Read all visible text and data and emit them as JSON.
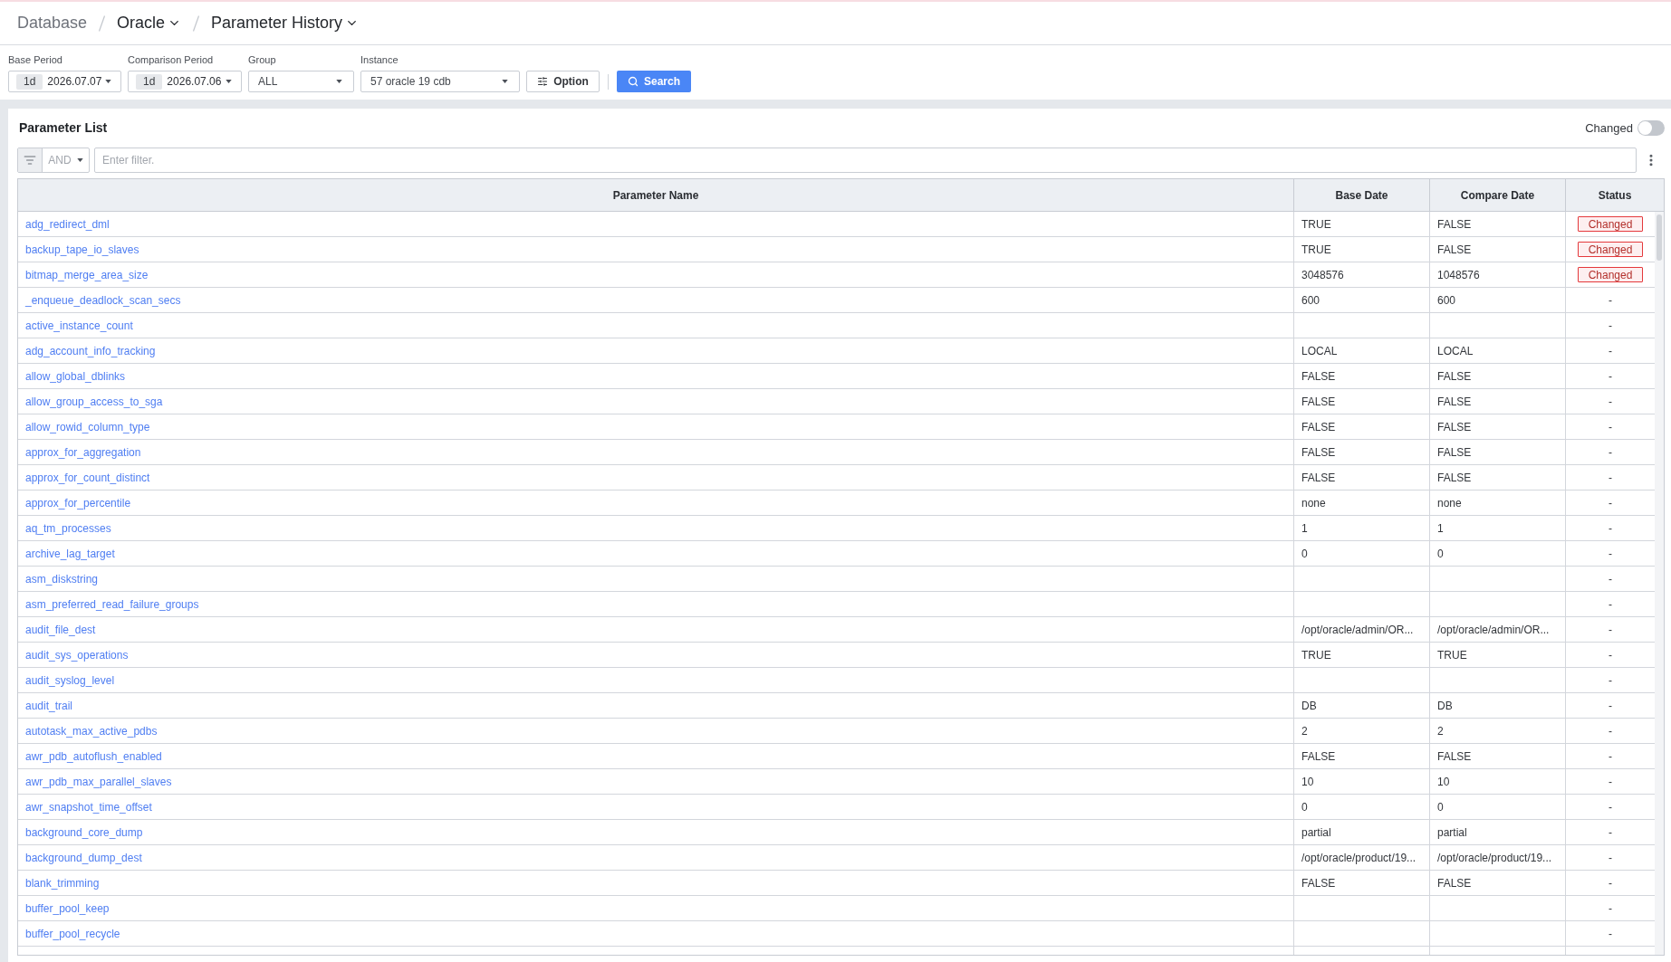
{
  "breadcrumb": [
    {
      "kind": "link",
      "label": "Database"
    },
    {
      "kind": "menu",
      "label": "Oracle"
    },
    {
      "kind": "menu",
      "label": "Parameter History"
    }
  ],
  "filters": [
    {
      "kind": "period",
      "label": "Base Period",
      "range": "1d",
      "value": "2026.07.07"
    },
    {
      "kind": "period",
      "label": "Comparison Period",
      "range": "1d",
      "value": "2026.07.06"
    },
    {
      "kind": "select",
      "label": "Group",
      "value": "ALL"
    },
    {
      "kind": "select",
      "label": "Instance",
      "value": "57 oracle 19 cdb"
    }
  ],
  "option_button": {
    "label": "Option"
  },
  "search_button": {
    "label": "Search"
  },
  "parameter_list": {
    "title": "Parameter List",
    "changed_filter": {
      "label": "Changed",
      "on": false
    },
    "filter": {
      "operator": "AND",
      "placeholder": "Enter filter."
    },
    "columns": [
      "Parameter Name",
      "Base Date",
      "Compare Date",
      "Status"
    ],
    "rows": [
      {
        "name": "adg_redirect_dml",
        "base": "TRUE",
        "compare": "FALSE",
        "status": "Changed",
        "changed": true
      },
      {
        "name": "backup_tape_io_slaves",
        "base": "TRUE",
        "compare": "FALSE",
        "status": "Changed",
        "changed": true
      },
      {
        "name": "bitmap_merge_area_size",
        "base": "3048576",
        "compare": "1048576",
        "status": "Changed",
        "changed": true
      },
      {
        "name": "_enqueue_deadlock_scan_secs",
        "base": "600",
        "compare": "600",
        "status": "-",
        "changed": false
      },
      {
        "name": "active_instance_count",
        "status": "-",
        "changed": false
      },
      {
        "name": "adg_account_info_tracking",
        "base": "LOCAL",
        "compare": "LOCAL",
        "status": "-",
        "changed": false
      },
      {
        "name": "allow_global_dblinks",
        "base": "FALSE",
        "compare": "FALSE",
        "status": "-",
        "changed": false
      },
      {
        "name": "allow_group_access_to_sga",
        "base": "FALSE",
        "compare": "FALSE",
        "status": "-",
        "changed": false
      },
      {
        "name": "allow_rowid_column_type",
        "base": "FALSE",
        "compare": "FALSE",
        "status": "-",
        "changed": false
      },
      {
        "name": "approx_for_aggregation",
        "base": "FALSE",
        "compare": "FALSE",
        "status": "-",
        "changed": false
      },
      {
        "name": "approx_for_count_distinct",
        "base": "FALSE",
        "compare": "FALSE",
        "status": "-",
        "changed": false
      },
      {
        "name": "approx_for_percentile",
        "base": "none",
        "compare": "none",
        "status": "-",
        "changed": false
      },
      {
        "name": "aq_tm_processes",
        "base": "1",
        "compare": "1",
        "status": "-",
        "changed": false
      },
      {
        "name": "archive_lag_target",
        "base": "0",
        "compare": "0",
        "status": "-",
        "changed": false
      },
      {
        "name": "asm_diskstring",
        "status": "-",
        "changed": false
      },
      {
        "name": "asm_preferred_read_failure_groups",
        "status": "-",
        "changed": false
      },
      {
        "name": "audit_file_dest",
        "base": "/opt/oracle/admin/OR...",
        "compare": "/opt/oracle/admin/OR...",
        "status": "-",
        "changed": false
      },
      {
        "name": "audit_sys_operations",
        "base": "TRUE",
        "compare": "TRUE",
        "status": "-",
        "changed": false
      },
      {
        "name": "audit_syslog_level",
        "status": "-",
        "changed": false
      },
      {
        "name": "audit_trail",
        "base": "DB",
        "compare": "DB",
        "status": "-",
        "changed": false
      },
      {
        "name": "autotask_max_active_pdbs",
        "base": "2",
        "compare": "2",
        "status": "-",
        "changed": false
      },
      {
        "name": "awr_pdb_autoflush_enabled",
        "base": "FALSE",
        "compare": "FALSE",
        "status": "-",
        "changed": false
      },
      {
        "name": "awr_pdb_max_parallel_slaves",
        "base": "10",
        "compare": "10",
        "status": "-",
        "changed": false
      },
      {
        "name": "awr_snapshot_time_offset",
        "base": "0",
        "compare": "0",
        "status": "-",
        "changed": false
      },
      {
        "name": "background_core_dump",
        "base": "partial",
        "compare": "partial",
        "status": "-",
        "changed": false
      },
      {
        "name": "background_dump_dest",
        "base": "/opt/oracle/product/19...",
        "compare": "/opt/oracle/product/19...",
        "status": "-",
        "changed": false
      },
      {
        "name": "blank_trimming",
        "base": "FALSE",
        "compare": "FALSE",
        "status": "-",
        "changed": false
      },
      {
        "name": "buffer_pool_keep",
        "status": "-",
        "changed": false
      },
      {
        "name": "buffer_pool_recycle",
        "status": "-",
        "changed": false
      }
    ]
  }
}
